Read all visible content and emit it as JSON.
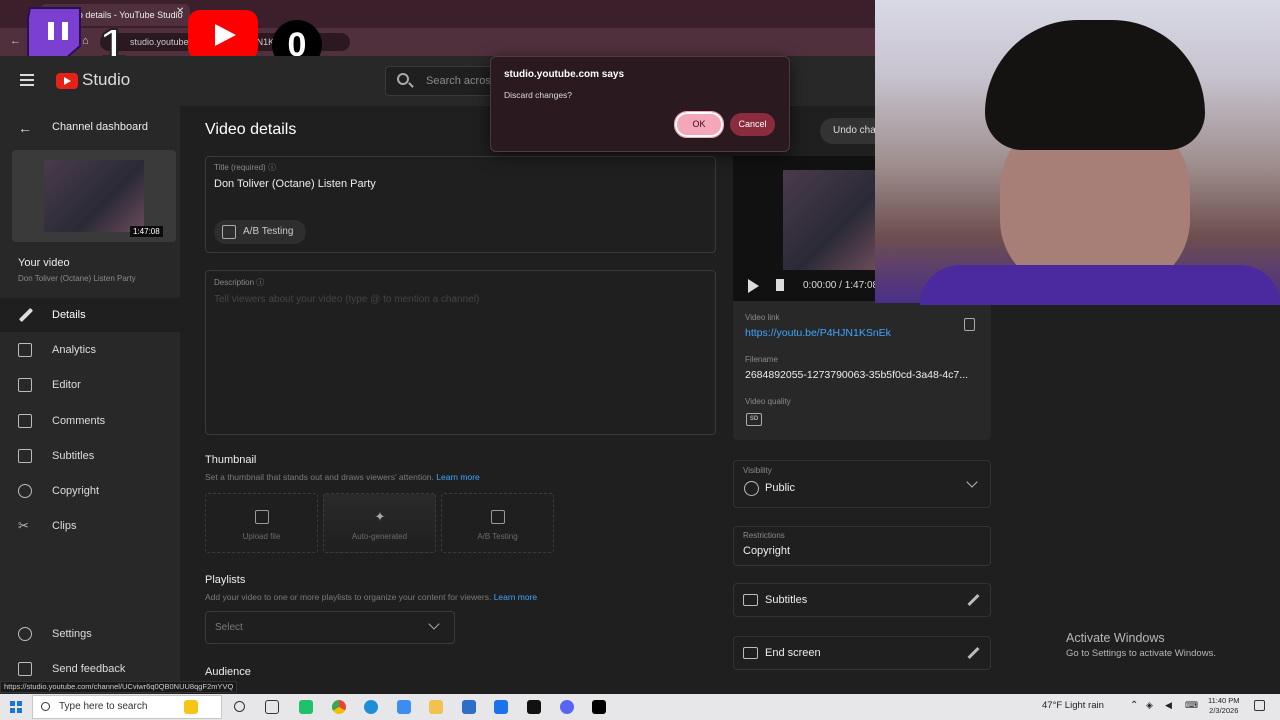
{
  "browser": {
    "tab_title": "Video details - YouTube Studio",
    "url": "studio.youtube.com/video/P4HJN1KSnEk",
    "status_url": "https://studio.youtube.com/channel/UCviwr6q0QB0NUU8qgF2mYVQ"
  },
  "overlay": {
    "twitch_count": "1",
    "youtube_count": "0"
  },
  "header": {
    "studio_label": "Studio",
    "search_placeholder": "Search across your channel"
  },
  "dialog": {
    "title": "studio.youtube.com says",
    "message": "Discard changes?",
    "ok_label": "OK",
    "cancel_label": "Cancel"
  },
  "sidebar": {
    "back_label": "Channel dashboard",
    "thumb_duration": "1:47:08",
    "your_video_label": "Your video",
    "video_title": "Don Toliver (Octane) Listen Party",
    "items": [
      {
        "label": "Details",
        "icon": "pencil-icon"
      },
      {
        "label": "Analytics",
        "icon": "analytics-icon"
      },
      {
        "label": "Editor",
        "icon": "editor-icon"
      },
      {
        "label": "Comments",
        "icon": "comments-icon"
      },
      {
        "label": "Subtitles",
        "icon": "subtitles-icon"
      },
      {
        "label": "Copyright",
        "icon": "copyright-icon"
      },
      {
        "label": "Clips",
        "icon": "scissors-icon"
      }
    ],
    "settings_label": "Settings",
    "feedback_label": "Send feedback"
  },
  "main": {
    "page_title": "Video details",
    "undo_label": "Undo changes",
    "title_label": "Title (required)",
    "title_value": "Don Toliver (Octane) Listen Party",
    "ab_label": "A/B Testing",
    "description_label": "Description",
    "description_placeholder": "Tell viewers about your video (type @ to mention a channel)",
    "thumbnail_heading": "Thumbnail",
    "thumbnail_sub": "Set a thumbnail that stands out and draws viewers' attention.",
    "learn_more": "Learn more",
    "thumb_options": [
      "Upload file",
      "Auto-generated",
      "A/B Testing"
    ],
    "playlists_heading": "Playlists",
    "playlists_sub": "Add your video to one or more playlists to organize your content for viewers.",
    "playlist_select": "Select",
    "audience_heading": "Audience"
  },
  "right": {
    "video_time": "0:00:00 / 1:47:08",
    "video_link_label": "Video link",
    "video_link": "https://youtu.be/P4HJN1KSnEk",
    "filename_label": "Filename",
    "filename": "2684892055-1273790063-35b5f0cd-3a48-4c7...",
    "quality_label": "Video quality",
    "quality_badge": "SD",
    "visibility_label": "Visibility",
    "visibility_value": "Public",
    "restrictions_label": "Restrictions",
    "restrictions_value": "Copyright",
    "subtitles_label": "Subtitles",
    "endscreen_label": "End screen"
  },
  "windows": {
    "activate_title": "Activate Windows",
    "activate_sub": "Go to Settings to activate Windows."
  },
  "taskbar": {
    "search_placeholder": "Type here to search",
    "weather": "47°F  Light rain",
    "time": "11:40 PM",
    "date": "2/3/2026"
  },
  "colors": {
    "accent": "#3ea6ff",
    "dialog_ok": "#f4a7b9",
    "dialog_cancel": "#8a2b3e",
    "browser_chrome": "#51303e"
  }
}
